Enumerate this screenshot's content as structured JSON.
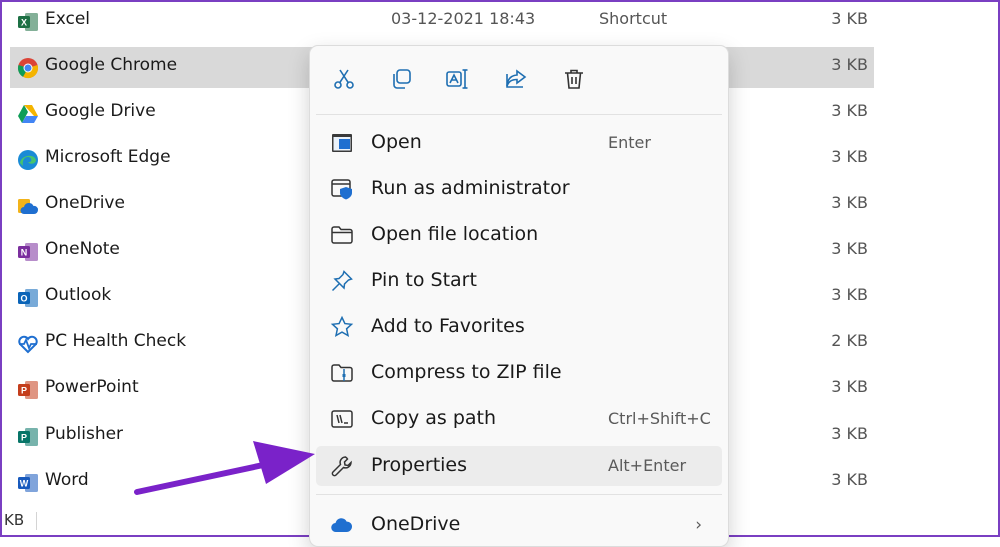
{
  "files": [
    {
      "name": "Excel",
      "date": "03-12-2021 18:43",
      "type": "Shortcut",
      "size": "3 KB",
      "icon": "excel-icon",
      "color": "#1d7044"
    },
    {
      "name": "Google Chrome",
      "date": "",
      "type": "",
      "size": "3 KB",
      "icon": "chrome-icon",
      "color": "#4285f4"
    },
    {
      "name": "Google Drive",
      "date": "",
      "type": "",
      "size": "3 KB",
      "icon": "google-drive-icon",
      "color": "#0f9d58"
    },
    {
      "name": "Microsoft Edge",
      "date": "",
      "type": "",
      "size": "3 KB",
      "icon": "edge-icon",
      "color": "#1a8bd6"
    },
    {
      "name": "OneDrive",
      "date": "",
      "type": "",
      "size": "3 KB",
      "icon": "onedrive-icon",
      "color": "#f2b31a"
    },
    {
      "name": "OneNote",
      "date": "",
      "type": "",
      "size": "3 KB",
      "icon": "onenote-icon",
      "color": "#7b2f9e"
    },
    {
      "name": "Outlook",
      "date": "",
      "type": "",
      "size": "3 KB",
      "icon": "outlook-icon",
      "color": "#0a64b8"
    },
    {
      "name": "PC Health Check",
      "date": "",
      "type": "",
      "size": "2 KB",
      "icon": "health-check-icon",
      "color": "#1f6fd0"
    },
    {
      "name": "PowerPoint",
      "date": "",
      "type": "",
      "size": "3 KB",
      "icon": "powerpoint-icon",
      "color": "#c43e1c"
    },
    {
      "name": "Publisher",
      "date": "",
      "type": "",
      "size": "3 KB",
      "icon": "publisher-icon",
      "color": "#077568"
    },
    {
      "name": "Word",
      "date": "",
      "type": "",
      "size": "3 KB",
      "icon": "word-icon",
      "color": "#185abd"
    }
  ],
  "status_bar": {
    "text": "KB"
  },
  "context_menu": {
    "toolbar": [
      {
        "icon": "cut-icon",
        "name": "cut-button"
      },
      {
        "icon": "copy-icon",
        "name": "copy-button"
      },
      {
        "icon": "rename-icon",
        "name": "rename-button"
      },
      {
        "icon": "share-icon",
        "name": "share-button"
      },
      {
        "icon": "delete-icon",
        "name": "delete-button"
      }
    ],
    "items": [
      {
        "label": "Open",
        "shortcut": "Enter",
        "icon": "open-icon"
      },
      {
        "label": "Run as administrator",
        "shortcut": "",
        "icon": "admin-shield-icon"
      },
      {
        "label": "Open file location",
        "shortcut": "",
        "icon": "folder-icon"
      },
      {
        "label": "Pin to Start",
        "shortcut": "",
        "icon": "pin-icon"
      },
      {
        "label": "Add to Favorites",
        "shortcut": "",
        "icon": "star-icon"
      },
      {
        "label": "Compress to ZIP file",
        "shortcut": "",
        "icon": "zip-icon"
      },
      {
        "label": "Copy as path",
        "shortcut": "Ctrl+Shift+C",
        "icon": "copy-path-icon"
      },
      {
        "label": "Properties",
        "shortcut": "Alt+Enter",
        "icon": "wrench-icon"
      }
    ],
    "submenu_item": {
      "label": "OneDrive",
      "chevron": "›",
      "icon": "onedrive-cloud-icon"
    }
  },
  "colors": {
    "selection": "#d9d9d9",
    "menu_bg": "#f9f9f9",
    "accent_blue": "#1f6fb2",
    "annotation_arrow": "#7a22c9",
    "frame_border": "#7a3fc2"
  }
}
